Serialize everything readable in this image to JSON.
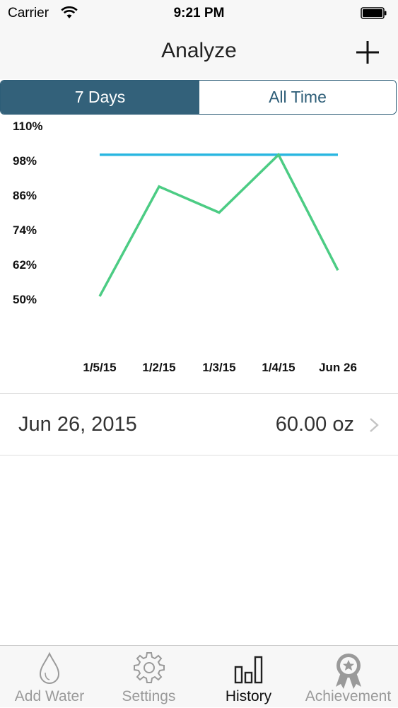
{
  "status_bar": {
    "carrier": "Carrier",
    "time": "9:21 PM"
  },
  "nav": {
    "title": "Analyze",
    "add_icon": "plus-icon"
  },
  "segments": [
    {
      "label": "7 Days",
      "selected": true
    },
    {
      "label": "All Time",
      "selected": false
    }
  ],
  "colors": {
    "accent": "#33617a",
    "goal_line": "#29b6e0",
    "data_line": "#4ccc84",
    "tab_inactive": "#9a9a9a"
  },
  "chart_data": {
    "type": "line",
    "categories": [
      "1/5/15",
      "1/2/15",
      "1/3/15",
      "1/4/15",
      "Jun 26"
    ],
    "y_ticks": [
      "110%",
      "98%",
      "86%",
      "74%",
      "62%",
      "50%"
    ],
    "ylim": [
      50,
      110
    ],
    "series": [
      {
        "values": [
          100,
          100,
          100,
          100,
          100
        ]
      },
      {
        "values": [
          51,
          89,
          80,
          100,
          60
        ]
      }
    ],
    "grid": false
  },
  "history": [
    {
      "date": "Jun 26, 2015",
      "amount": "60.00 oz"
    }
  ],
  "tabs": [
    {
      "label": "Add Water",
      "icon": "water-drop-icon",
      "active": false
    },
    {
      "label": "Settings",
      "icon": "gear-icon",
      "active": false
    },
    {
      "label": "History",
      "icon": "bar-chart-icon",
      "active": true
    },
    {
      "label": "Achievement",
      "icon": "award-ribbon-icon",
      "active": false
    }
  ]
}
